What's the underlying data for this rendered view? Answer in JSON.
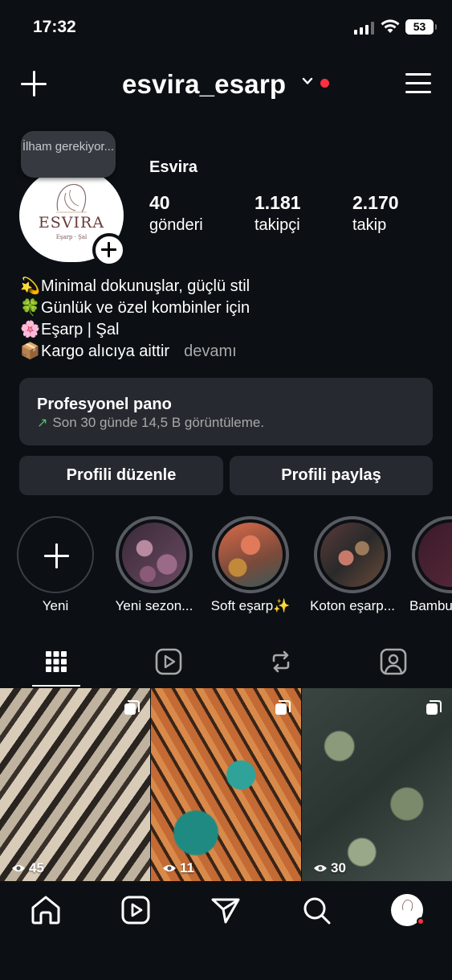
{
  "status_bar": {
    "time": "17:32",
    "battery": "53"
  },
  "header": {
    "username": "esvira_esarp"
  },
  "profile": {
    "note": "İlham gerekiyor...",
    "avatar_logo": "ESVIRA",
    "avatar_sub": "Eşarp · Şal",
    "display_name": "Esvira",
    "stats": [
      {
        "value": "40",
        "label": "gönderi"
      },
      {
        "value": "1.181",
        "label": "takipçi"
      },
      {
        "value": "2.170",
        "label": "takip"
      }
    ],
    "bio": [
      {
        "emoji": "💫",
        "text": "Minimal dokunuşlar, güçlü stil"
      },
      {
        "emoji": "🍀",
        "text": "Günlük ve özel kombinler için"
      },
      {
        "emoji": "🌸",
        "text": "Eşarp | Şal"
      },
      {
        "emoji": "📦",
        "text": "Kargo alıcıya aittir"
      }
    ],
    "more_label": "devamı"
  },
  "pro_dashboard": {
    "title": "Profesyonel pano",
    "subtitle": "Son 30 günde 14,5 B görüntüleme."
  },
  "buttons": {
    "edit_profile": "Profili düzenle",
    "share_profile": "Profili paylaş"
  },
  "highlights": [
    {
      "label": "Yeni"
    },
    {
      "label": "Yeni sezon..."
    },
    {
      "label": "Soft eşarp✨"
    },
    {
      "label": "Koton eşarp..."
    },
    {
      "label": "Bambu"
    }
  ],
  "posts": [
    {
      "views": "45"
    },
    {
      "views": "11"
    },
    {
      "views": "30"
    }
  ],
  "icons": {
    "create": "plus-icon",
    "account_switch": "chevron-down-icon",
    "menu": "hamburger-menu-icon",
    "tabs": [
      "grid-icon",
      "reels-icon",
      "reposts-icon",
      "tagged-icon"
    ],
    "bottom_nav": [
      "home-icon",
      "reels-icon",
      "send-icon",
      "search-icon",
      "profile-avatar"
    ]
  },
  "colors": {
    "background": "#0c1014",
    "card": "#262a30",
    "notification": "#ff3040",
    "trend": "#5ac26a"
  }
}
